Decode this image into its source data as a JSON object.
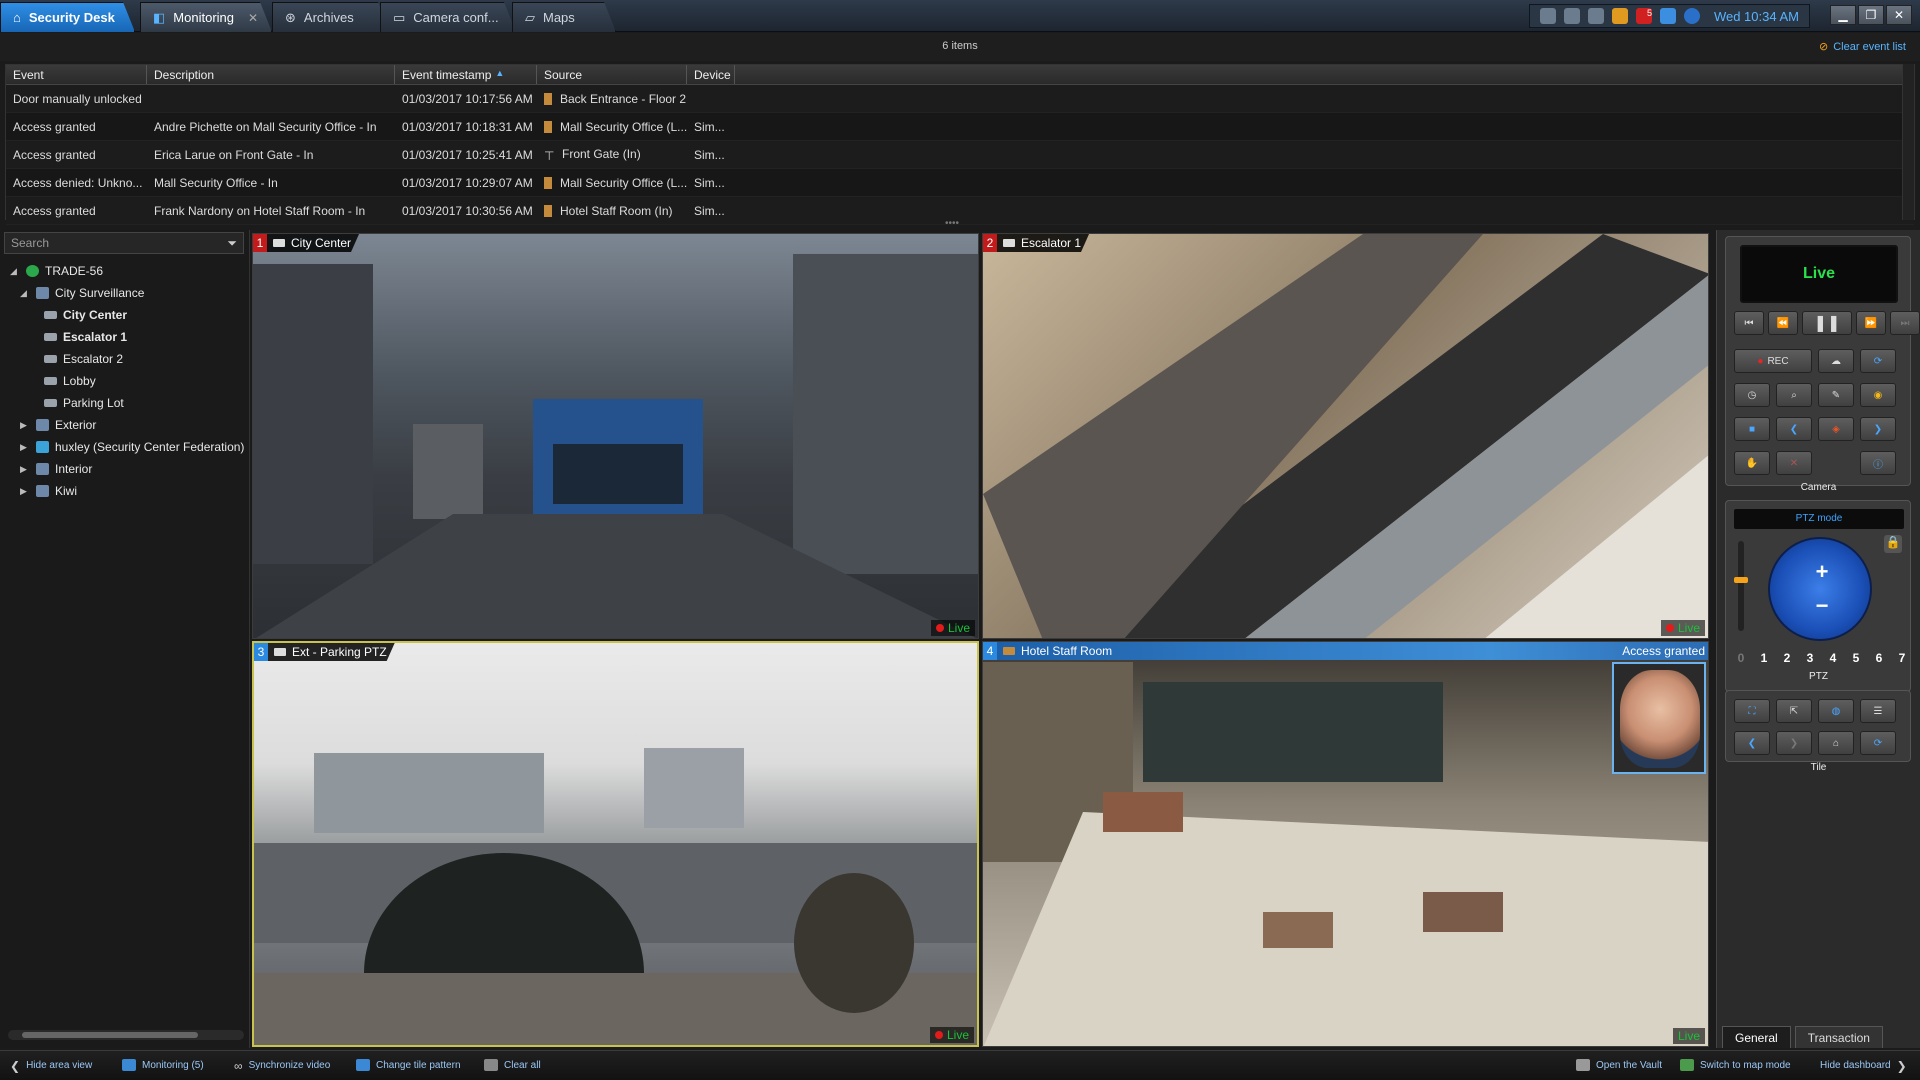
{
  "app": {
    "home_tab": "Security Desk"
  },
  "tabs": [
    {
      "label": "Monitoring",
      "active": true
    },
    {
      "label": "Archives",
      "active": false
    },
    {
      "label": "Camera conf...",
      "active": false
    },
    {
      "label": "Maps",
      "active": false
    }
  ],
  "tray": {
    "badge": "5",
    "clock": "Wed 10:34 AM"
  },
  "events": {
    "count_text": "6 items",
    "clear_label": "Clear event list",
    "columns": [
      "Event",
      "Description",
      "Event timestamp",
      "Source",
      "Device"
    ],
    "rows": [
      {
        "event": "Door manually unlocked",
        "description": "",
        "timestamp": "01/03/2017 10:17:56 AM",
        "source": "Back Entrance - Floor 2",
        "device": ""
      },
      {
        "event": "Access granted",
        "description": "Andre Pichette on Mall Security Office - In",
        "timestamp": "01/03/2017 10:18:31 AM",
        "source": "Mall Security Office (L...",
        "device": "Sim..."
      },
      {
        "event": "Access granted",
        "description": "Erica Larue on Front Gate - In",
        "timestamp": "01/03/2017 10:25:41 AM",
        "source": "Front Gate (In)",
        "device": "Sim..."
      },
      {
        "event": "Access denied: Unkno...",
        "description": "Mall Security Office - In",
        "timestamp": "01/03/2017 10:29:07 AM",
        "source": "Mall Security Office (L...",
        "device": "Sim..."
      },
      {
        "event": "Access granted",
        "description": "Frank Nardony on Hotel Staff Room - In",
        "timestamp": "01/03/2017 10:30:56 AM",
        "source": "Hotel Staff Room (In)",
        "device": "Sim..."
      }
    ]
  },
  "area_view": {
    "search_placeholder": "Search",
    "tree": [
      {
        "label": "TRADE-56",
        "icon": "globe-icon",
        "expander": "collapse"
      },
      {
        "label": "City Surveillance",
        "icon": "building-icon",
        "expander": "collapse"
      },
      {
        "label": "City Center",
        "icon": "camera-icon",
        "bold": true
      },
      {
        "label": "Escalator 1",
        "icon": "camera-icon",
        "bold": true
      },
      {
        "label": "Escalator 2",
        "icon": "camera-icon"
      },
      {
        "label": "Lobby",
        "icon": "camera-icon"
      },
      {
        "label": "Parking Lot",
        "icon": "camera-icon"
      },
      {
        "label": "Exterior",
        "icon": "building-icon",
        "expander": "expand"
      },
      {
        "label": "huxley (Security Center Federation)",
        "icon": "federation-icon",
        "expander": "expand"
      },
      {
        "label": "Interior",
        "icon": "building-icon",
        "expander": "expand"
      },
      {
        "label": "Kiwi",
        "icon": "building-icon",
        "expander": "expand"
      }
    ]
  },
  "tiles": [
    {
      "num": "1",
      "title": "City Center",
      "live": "Live"
    },
    {
      "num": "2",
      "title": "Escalator 1",
      "live": "Live"
    },
    {
      "num": "3",
      "title": "Ext - Parking PTZ",
      "live": "Live"
    },
    {
      "num": "4",
      "title": "Hotel Staff Room",
      "live": "Live",
      "overlay": "Access granted"
    }
  ],
  "dashboard": {
    "live_label": "Live",
    "rec_label": "REC",
    "camera_label": "Camera",
    "ptz_mode": "PTZ mode",
    "presets": [
      "0",
      "1",
      "2",
      "3",
      "4",
      "5",
      "6",
      "7"
    ],
    "ptz_label": "PTZ",
    "tile_label": "Tile",
    "tabs": [
      "General",
      "Transaction"
    ]
  },
  "bottom_bar": {
    "hide_area_view": "Hide area view",
    "monitoring": "Monitoring (5)",
    "sync_video": "Synchronize video",
    "change_tile": "Change tile pattern",
    "clear_all": "Clear all",
    "open_vault": "Open the Vault",
    "map_mode": "Switch to map mode",
    "hide_dashboard": "Hide dashboard"
  },
  "colors": {
    "accent": "#2b89e0",
    "live": "#18c23a",
    "alarm": "#c21b1b",
    "selected_tile": "#c8c24e"
  }
}
